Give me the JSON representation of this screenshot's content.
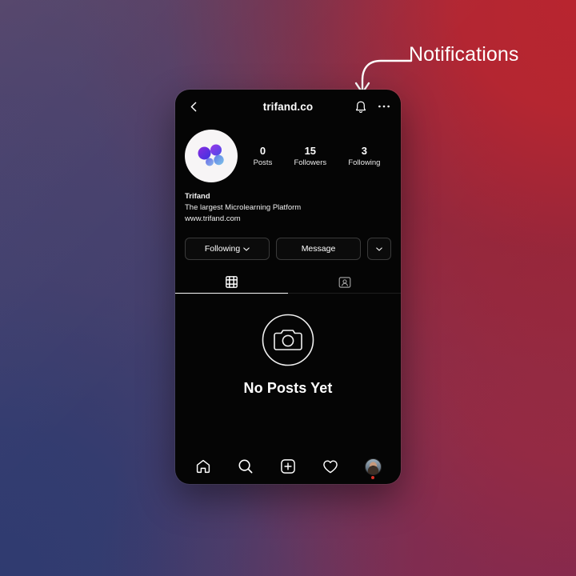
{
  "annotation": {
    "label": "Notifications",
    "arrow_icon": "curved-arrow-icon",
    "color": "#ffffff"
  },
  "background": {
    "colors": {
      "top_left": "#5b4364",
      "top_right": "#ab2430",
      "right_middle": "#9a2a40",
      "bottom_right": "#84284f",
      "bottom_middle": "#59456c",
      "bottom_left": "#2f3b70",
      "left_middle": "#453f6c"
    }
  },
  "phone": {
    "background": "#050505",
    "header": {
      "back_icon": "chevron-left-icon",
      "title": "trifand.co",
      "bell_icon": "bell-icon",
      "menu_icon": "ellipsis-horizontal-icon"
    },
    "profile": {
      "avatar_icon": "trifand-logo-avatar",
      "stats": [
        {
          "value": "0",
          "label": "Posts"
        },
        {
          "value": "15",
          "label": "Followers"
        },
        {
          "value": "3",
          "label": "Following"
        }
      ],
      "bio": {
        "name": "Trifand",
        "description": "The largest Microlearning Platform",
        "link": "www.trifand.com"
      },
      "actions": {
        "following_label": "Following",
        "following_chevron_icon": "chevron-down-icon",
        "message_label": "Message",
        "more_chevron_icon": "chevron-down-icon"
      }
    },
    "tabs": [
      {
        "name": "grid-tab",
        "icon": "grid-icon",
        "selected": true
      },
      {
        "name": "tagged-tab",
        "icon": "tagged-person-icon",
        "selected": false
      }
    ],
    "empty_state": {
      "icon": "camera-icon",
      "title": "No Posts Yet"
    },
    "bottom_nav": [
      {
        "name": "home",
        "icon": "home-icon"
      },
      {
        "name": "search",
        "icon": "search-icon"
      },
      {
        "name": "create",
        "icon": "plus-square-icon"
      },
      {
        "name": "activity",
        "icon": "heart-icon"
      },
      {
        "name": "profile",
        "icon": "avatar-icon",
        "badge_color": "#d93025"
      }
    ]
  }
}
